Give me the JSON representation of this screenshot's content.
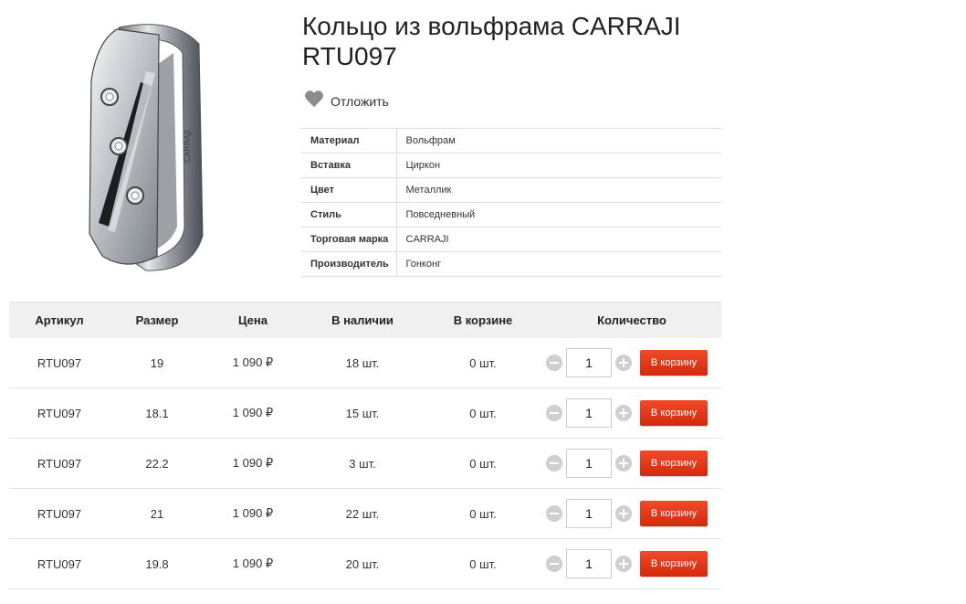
{
  "product": {
    "title": "Кольцо из вольфрама CARRAJI RTU097",
    "image_alt": "ring-image",
    "engraving": "CARRAJI"
  },
  "wishlist": {
    "label": "Отложить",
    "icon": "heart-icon",
    "icon_color": "#8c8c8c"
  },
  "properties": [
    {
      "key": "Материал",
      "value": "Вольфрам"
    },
    {
      "key": "Вставка",
      "value": "Циркон"
    },
    {
      "key": "Цвет",
      "value": "Металлик"
    },
    {
      "key": "Стиль",
      "value": "Повседневный"
    },
    {
      "key": "Торговая марка",
      "value": "CARRAJI"
    },
    {
      "key": "Производитель",
      "value": "Гонконг"
    }
  ],
  "offers": {
    "headers": {
      "article": "Артикул",
      "size": "Размер",
      "price": "Цена",
      "stock": "В наличии",
      "in_cart": "В корзине",
      "quantity": "Количество"
    },
    "rows": [
      {
        "article": "RTU097",
        "size": "19",
        "price": "1 090 ₽",
        "stock": "18 шт.",
        "in_cart": "0 шт.",
        "qty": "1",
        "button": "В корзину"
      },
      {
        "article": "RTU097",
        "size": "18.1",
        "price": "1 090 ₽",
        "stock": "15 шт.",
        "in_cart": "0 шт.",
        "qty": "1",
        "button": "В корзину"
      },
      {
        "article": "RTU097",
        "size": "22.2",
        "price": "1 090 ₽",
        "stock": "3 шт.",
        "in_cart": "0 шт.",
        "qty": "1",
        "button": "В корзину"
      },
      {
        "article": "RTU097",
        "size": "21",
        "price": "1 090 ₽",
        "stock": "22 шт.",
        "in_cart": "0 шт.",
        "qty": "1",
        "button": "В корзину"
      },
      {
        "article": "RTU097",
        "size": "19.8",
        "price": "1 090 ₽",
        "stock": "20 шт.",
        "in_cart": "0 шт.",
        "qty": "1",
        "button": "В корзину"
      }
    ]
  },
  "colors": {
    "accent_button": "#e3391b",
    "header_bg": "#f0f0f0",
    "qty_control": "#cfcfcf"
  }
}
